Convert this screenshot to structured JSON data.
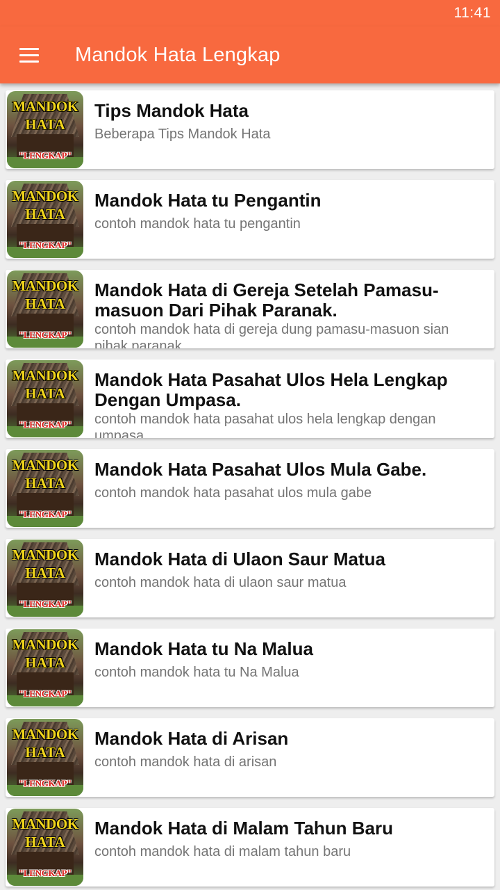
{
  "status_bar": {
    "time": "11:41"
  },
  "app_bar": {
    "title": "Mandok Hata Lengkap",
    "menu_icon": "hamburger-menu-icon"
  },
  "colors": {
    "accent": "#f8693f",
    "background": "#eeeeee",
    "card": "#ffffff",
    "title_text": "#111111",
    "subtitle_text": "#757575"
  },
  "thumbnail": {
    "line1": "MANDOK",
    "line2": "HATA",
    "line3": "\"LENGKAP\""
  },
  "items": [
    {
      "title": "Tips Mandok Hata",
      "subtitle": "Beberapa Tips Mandok Hata"
    },
    {
      "title": "Mandok Hata tu Pengantin",
      "subtitle": "contoh mandok hata tu pengantin"
    },
    {
      "title": "Mandok Hata di Gereja Setelah Pamasu-masuon Dari Pihak Paranak.",
      "subtitle": "contoh mandok hata di gereja dung pamasu-masuon sian pihak paranak"
    },
    {
      "title": "Mandok Hata Pasahat Ulos Hela Lengkap Dengan Umpasa.",
      "subtitle": "contoh mandok hata pasahat ulos hela lengkap dengan umpasa"
    },
    {
      "title": "Mandok Hata Pasahat Ulos Mula Gabe.",
      "subtitle": "contoh mandok hata pasahat ulos mula gabe"
    },
    {
      "title": "Mandok Hata di Ulaon Saur Matua",
      "subtitle": "contoh mandok hata di ulaon saur matua"
    },
    {
      "title": "Mandok Hata tu Na Malua",
      "subtitle": "contoh mandok hata tu Na Malua"
    },
    {
      "title": "Mandok Hata di Arisan",
      "subtitle": "contoh mandok hata di arisan"
    },
    {
      "title": "Mandok Hata di Malam Tahun Baru",
      "subtitle": "contoh mandok hata di malam tahun baru"
    }
  ]
}
